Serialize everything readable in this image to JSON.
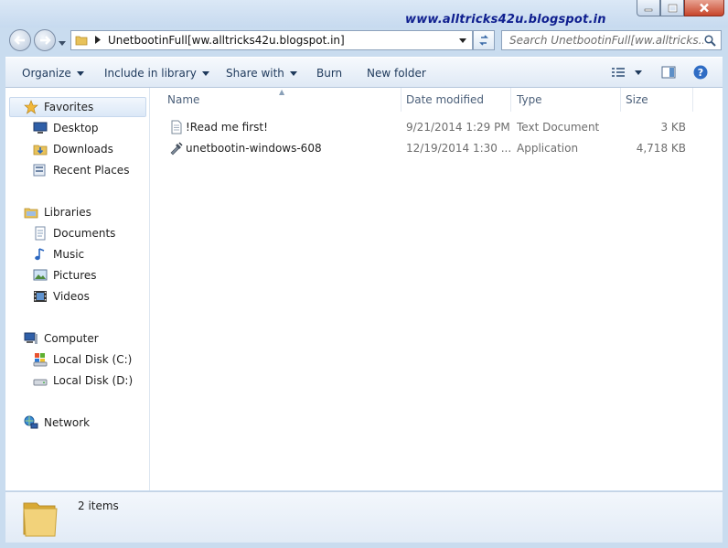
{
  "window": {
    "watermark": "www.alltricks42u.blogspot.in"
  },
  "address": {
    "path": "UnetbootinFull[ww.alltricks42u.blogspot.in]"
  },
  "search": {
    "placeholder": "Search UnetbootinFull[ww.alltricks..."
  },
  "toolbar": {
    "organize": "Organize",
    "include_in_library": "Include in library",
    "share_with": "Share with",
    "burn": "Burn",
    "new_folder": "New folder"
  },
  "sidebar": {
    "favorites": "Favorites",
    "desktop": "Desktop",
    "downloads": "Downloads",
    "recent_places": "Recent Places",
    "libraries": "Libraries",
    "documents": "Documents",
    "music": "Music",
    "pictures": "Pictures",
    "videos": "Videos",
    "computer": "Computer",
    "local_disk_c": "Local Disk (C:)",
    "local_disk_d": "Local Disk (D:)",
    "network": "Network"
  },
  "columns": {
    "name": "Name",
    "date_modified": "Date modified",
    "type": "Type",
    "size": "Size"
  },
  "files": [
    {
      "name": "!Read me first!",
      "date": "9/21/2014 1:29 PM",
      "type": "Text Document",
      "size": "3 KB",
      "icon": "text-file-icon"
    },
    {
      "name": "unetbootin-windows-608",
      "date": "12/19/2014 1:30 ...",
      "type": "Application",
      "size": "4,718 KB",
      "icon": "application-icon"
    }
  ],
  "status": {
    "items": "2 items"
  }
}
